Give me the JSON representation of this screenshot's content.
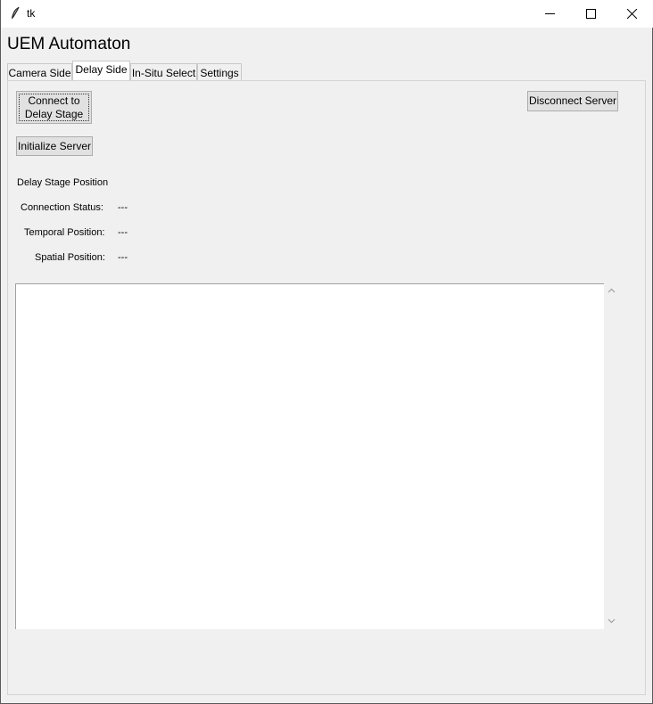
{
  "window": {
    "title": "tk"
  },
  "app": {
    "heading": "UEM Automaton"
  },
  "tabs": [
    {
      "label": "Camera Side"
    },
    {
      "label": "Delay Side",
      "active": true
    },
    {
      "label": "In-Situ Select"
    },
    {
      "label": "Settings"
    }
  ],
  "buttons": {
    "connect_line1": "Connect to",
    "connect_line2": "Delay Stage",
    "initialize": "Initialize Server",
    "disconnect": "Disconnect Server"
  },
  "status": {
    "section_title": "Delay Stage Position",
    "connection_label": "Connection Status:",
    "connection_value": "---",
    "temporal_label": "Temporal Position:",
    "temporal_value": "---",
    "spatial_label": "Spatial Position:",
    "spatial_value": "---"
  },
  "log": {
    "text": ""
  }
}
